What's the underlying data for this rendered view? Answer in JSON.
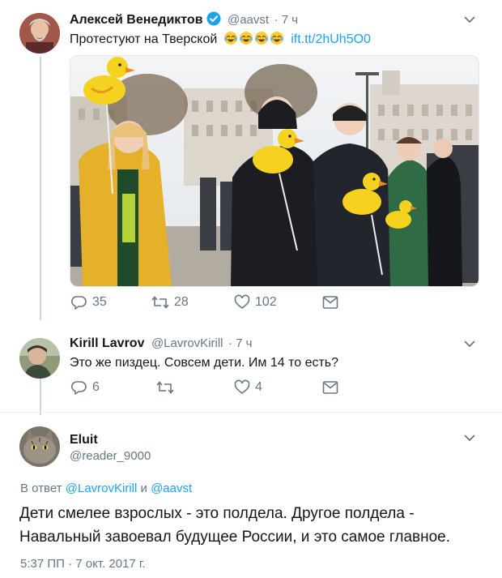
{
  "tweet1": {
    "author_name": "Алексей Венедиктов",
    "handle": "@aavst",
    "time": "· 7 ч",
    "text": "Протестуют на Тверской",
    "emoji_count": 4,
    "link": "ift.tt/2hUh5O0",
    "replies": "35",
    "retweets": "28",
    "likes": "102"
  },
  "tweet2": {
    "author_name": "Kirill Lavrov",
    "handle": "@LavrovKirill",
    "time": "· 7 ч",
    "text": "Это же пиздец. Совсем дети. Им 14 то есть?",
    "replies": "6",
    "retweets": "",
    "likes": "4"
  },
  "tweet3": {
    "author_name": "Eluit",
    "handle": "@reader_9000",
    "reply_prefix": "В ответ",
    "reply_user1": "@LavrovKirill",
    "reply_and": "и",
    "reply_user2": "@aavst",
    "text_line1": "Дети смелее взрослых - это полдела. Другое полдела -",
    "text_line2": "Навальный завоевал будущее России, и это самое главное.",
    "timestamp": "5:37 ПП · 7 окт. 2017 г."
  },
  "colors": {
    "accent": "#1da1f2",
    "muted": "#657786",
    "thread_line": "#ccd6dd",
    "duck_yellow": "#f5d21f"
  },
  "icons": [
    "reply-icon",
    "retweet-icon",
    "like-icon",
    "dm-icon",
    "chevron-down-icon",
    "verified-badge-icon"
  ]
}
